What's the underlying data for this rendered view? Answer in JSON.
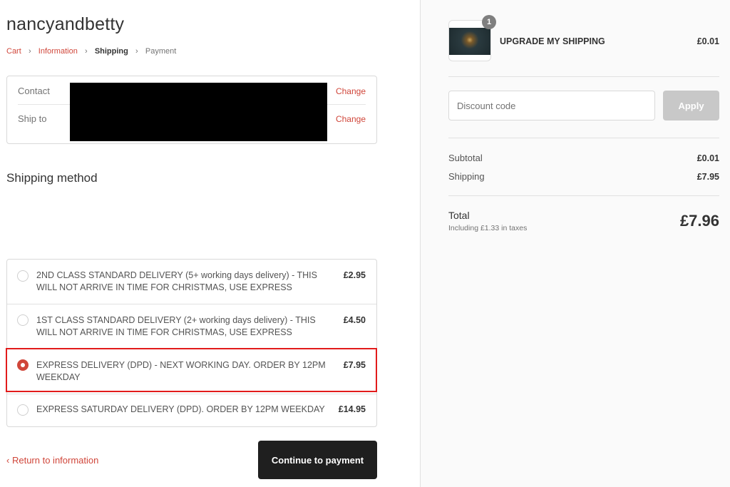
{
  "shop": {
    "title": "nancyandbetty"
  },
  "breadcrumb": {
    "cart": "Cart",
    "information": "Information",
    "shipping": "Shipping",
    "payment": "Payment",
    "separator_icon": "chevron-right-icon"
  },
  "review": {
    "contact_label": "Contact",
    "ship_to_label": "Ship to",
    "change_label": "Change"
  },
  "shipping": {
    "section_title": "Shipping method",
    "methods": [
      {
        "label": "2ND CLASS STANDARD DELIVERY (5+ working days delivery) - THIS WILL NOT ARRIVE IN TIME FOR CHRISTMAS, USE EXPRESS",
        "price": "£2.95",
        "selected": false
      },
      {
        "label": "1ST CLASS STANDARD DELIVERY (2+ working days delivery) - THIS WILL NOT ARRIVE IN TIME FOR CHRISTMAS, USE EXPRESS",
        "price": "£4.50",
        "selected": false
      },
      {
        "label": "EXPRESS DELIVERY (DPD) - NEXT WORKING DAY. ORDER BY 12PM WEEKDAY",
        "price": "£7.95",
        "selected": true
      },
      {
        "label": "EXPRESS SATURDAY DELIVERY (DPD). ORDER BY 12PM WEEKDAY",
        "price": "£14.95",
        "selected": false
      }
    ]
  },
  "footer": {
    "return_label": "Return to information",
    "return_icon": "chevron-left-icon",
    "continue_label": "Continue to payment"
  },
  "summary": {
    "product": {
      "name": "UPGRADE MY SHIPPING",
      "price": "£0.01",
      "quantity": "1"
    },
    "discount": {
      "placeholder": "Discount code",
      "apply_label": "Apply"
    },
    "subtotal_label": "Subtotal",
    "subtotal_value": "£0.01",
    "shipping_label": "Shipping",
    "shipping_value": "£7.95",
    "total_label": "Total",
    "tax_note": "Including £1.33 in taxes",
    "total_value": "£7.96"
  },
  "colors": {
    "accent": "#d0463a",
    "button_dark": "#1f1f1f",
    "highlight_outline": "#e21b1b",
    "apply_disabled": "#c8c8c8"
  }
}
